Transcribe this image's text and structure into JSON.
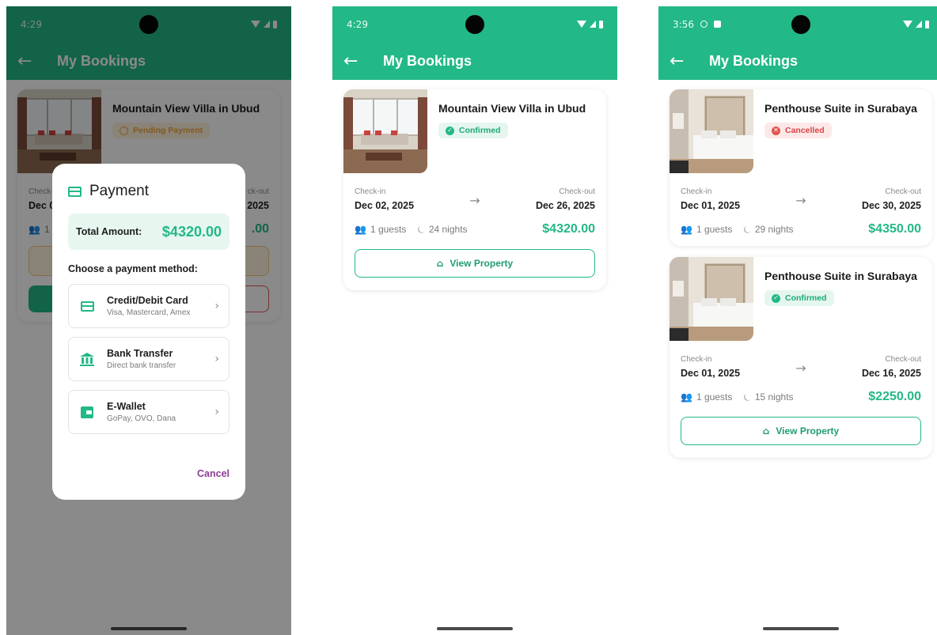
{
  "colors": {
    "primary": "#23b887",
    "price": "#23b887",
    "confirmed": "#1fa97a",
    "cancelled": "#d64545",
    "pending": "#f0a43b",
    "cancel_text": "#8b3f96"
  },
  "screens": [
    {
      "status": {
        "time": "4:29"
      },
      "appbar": {
        "back_icon": "arrow-left-icon",
        "title": "My Bookings"
      },
      "booking": {
        "name": "Mountain View Villa in Ubud",
        "status": "Pending Payment",
        "checkin_label": "Check-in",
        "checkin_partial": "Dec 0",
        "checkout_label": "Check-out",
        "checkout_label_partial": "ck-out",
        "checkout_partial": "2025",
        "guests_partial": "1",
        "price_partial": ".00"
      },
      "dialog": {
        "title": "Payment",
        "total_label": "Total Amount:",
        "total_value": "$4320.00",
        "choose_label": "Choose a payment method:",
        "methods": [
          {
            "title": "Credit/Debit Card",
            "subtitle": "Visa, Mastercard, Amex",
            "icon": "credit-card-icon"
          },
          {
            "title": "Bank Transfer",
            "subtitle": "Direct bank transfer",
            "icon": "bank-icon"
          },
          {
            "title": "E-Wallet",
            "subtitle": "GoPay, OVO, Dana",
            "icon": "wallet-icon"
          }
        ],
        "cancel_label": "Cancel"
      }
    },
    {
      "status": {
        "time": "4:29"
      },
      "appbar": {
        "back_icon": "arrow-left-icon",
        "title": "My Bookings"
      },
      "bookings": [
        {
          "name": "Mountain View Villa in Ubud",
          "status": "Confirmed",
          "checkin_label": "Check-in",
          "checkin": "Dec 02, 2025",
          "checkout_label": "Check-out",
          "checkout": "Dec 26, 2025",
          "guests": "1 guests",
          "nights": "24 nights",
          "price": "$4320.00",
          "button": "View Property"
        }
      ]
    },
    {
      "status": {
        "time": "3:56"
      },
      "appbar": {
        "back_icon": "arrow-left-icon",
        "title": "My Bookings"
      },
      "bookings": [
        {
          "name": "Penthouse Suite in Surabaya",
          "status": "Cancelled",
          "checkin_label": "Check-in",
          "checkin": "Dec 01, 2025",
          "checkout_label": "Check-out",
          "checkout": "Dec 30, 2025",
          "guests": "1 guests",
          "nights": "29 nights",
          "price": "$4350.00"
        },
        {
          "name": "Penthouse Suite in Surabaya",
          "status": "Confirmed",
          "checkin_label": "Check-in",
          "checkin": "Dec 01, 2025",
          "checkout_label": "Check-out",
          "checkout": "Dec 16, 2025",
          "guests": "1 guests",
          "nights": "15 nights",
          "price": "$2250.00",
          "button": "View Property"
        }
      ]
    }
  ]
}
